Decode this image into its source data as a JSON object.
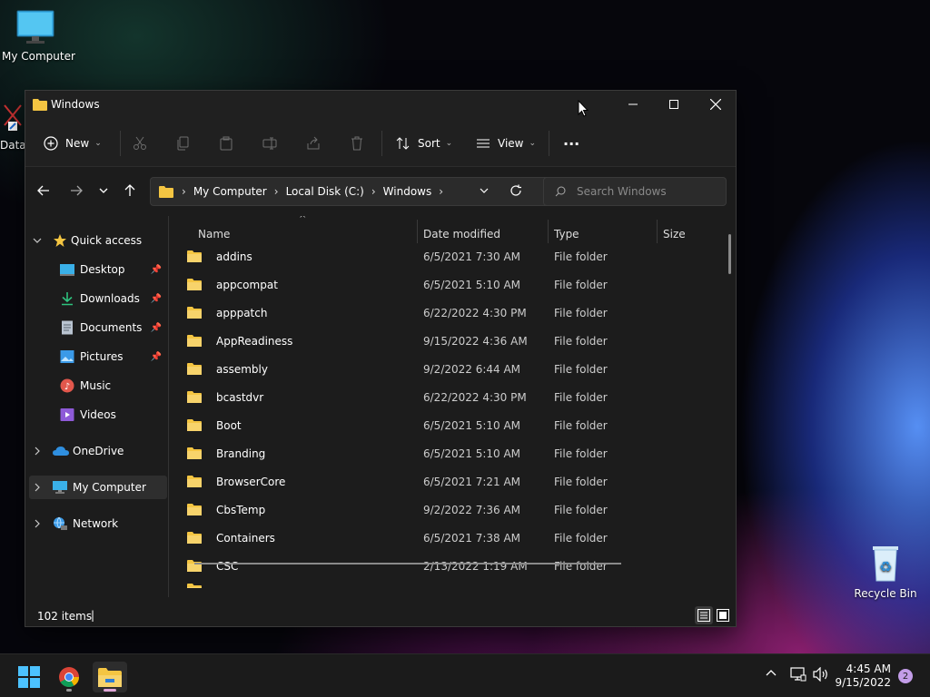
{
  "desktop": {
    "my_computer_label": "My Computer",
    "data_label": "Data",
    "recycle_bin_label": "Recycle Bin"
  },
  "window": {
    "title": "Windows",
    "toolbar": {
      "new_label": "New",
      "sort_label": "Sort",
      "view_label": "View",
      "more_label": "···"
    },
    "address": {
      "crumbs": [
        "My Computer",
        "Local Disk (C:)",
        "Windows"
      ]
    },
    "search": {
      "placeholder": "Search Windows"
    },
    "sidebar": {
      "quick_access": "Quick access",
      "items": [
        "Desktop",
        "Downloads",
        "Documents",
        "Pictures",
        "Music",
        "Videos"
      ],
      "onedrive": "OneDrive",
      "my_computer": "My Computer",
      "network": "Network"
    },
    "columns": {
      "name": "Name",
      "date": "Date modified",
      "type": "Type",
      "size": "Size"
    },
    "files": [
      {
        "name": "addins",
        "date": "6/5/2021 7:30 AM",
        "type": "File folder"
      },
      {
        "name": "appcompat",
        "date": "6/5/2021 5:10 AM",
        "type": "File folder"
      },
      {
        "name": "apppatch",
        "date": "6/22/2022 4:30 PM",
        "type": "File folder"
      },
      {
        "name": "AppReadiness",
        "date": "9/15/2022 4:36 AM",
        "type": "File folder"
      },
      {
        "name": "assembly",
        "date": "9/2/2022 6:44 AM",
        "type": "File folder"
      },
      {
        "name": "bcastdvr",
        "date": "6/22/2022 4:30 PM",
        "type": "File folder"
      },
      {
        "name": "Boot",
        "date": "6/5/2021 5:10 AM",
        "type": "File folder"
      },
      {
        "name": "Branding",
        "date": "6/5/2021 5:10 AM",
        "type": "File folder"
      },
      {
        "name": "BrowserCore",
        "date": "6/5/2021 7:21 AM",
        "type": "File folder"
      },
      {
        "name": "CbsTemp",
        "date": "9/2/2022 7:36 AM",
        "type": "File folder"
      },
      {
        "name": "Containers",
        "date": "6/5/2021 7:38 AM",
        "type": "File folder"
      },
      {
        "name": "CSC",
        "date": "2/13/2022 1:19 AM",
        "type": "File folder"
      }
    ],
    "status": {
      "item_count": "102 items",
      "cursor": "|"
    }
  },
  "taskbar": {
    "time": "4:45 AM",
    "date": "9/15/2022",
    "notification_count": "2"
  },
  "colors": {
    "folder": "#f4c542",
    "accent": "#60cdff",
    "window_bg": "#1c1c1c"
  }
}
